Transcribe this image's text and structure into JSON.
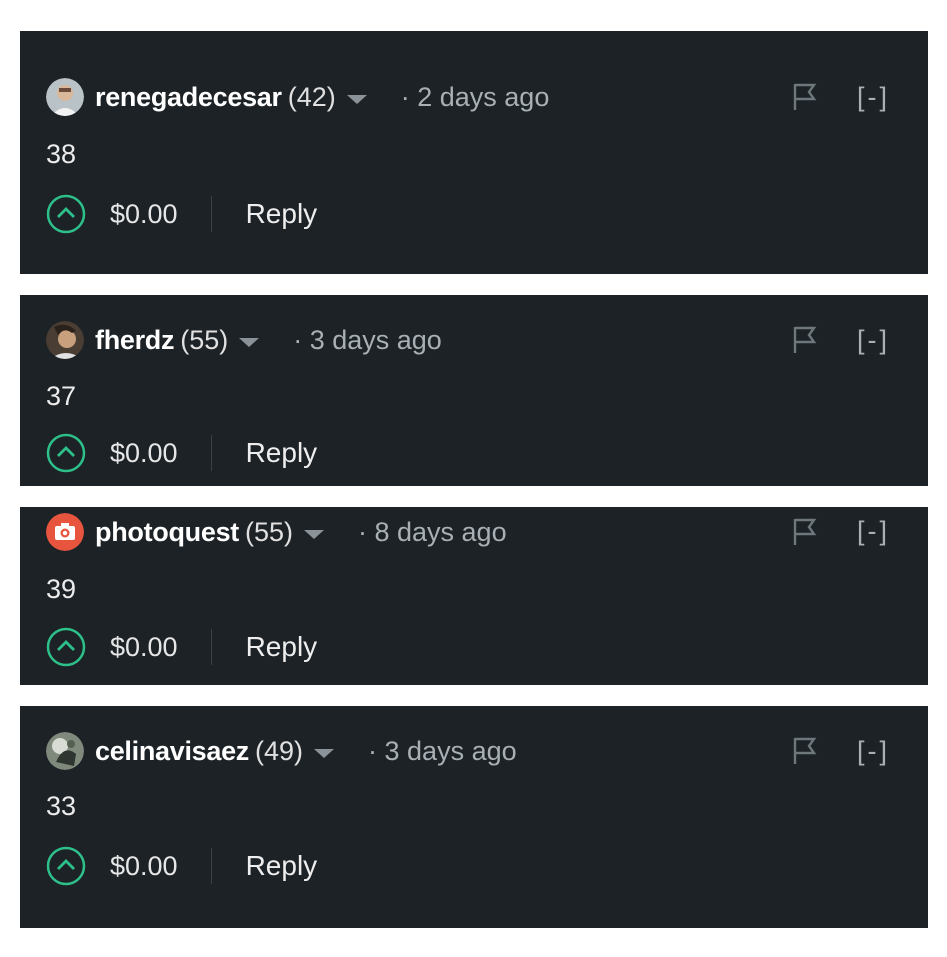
{
  "comments": [
    {
      "author": "renegadecesar",
      "reputation": "(42)",
      "time": "· 2 days ago",
      "body": "38",
      "payout": "$0.00",
      "reply": "Reply",
      "collapse": "[-]",
      "avatar": "portrait-avatar"
    },
    {
      "author": "fherdz",
      "reputation": "(55)",
      "time": "· 3 days ago",
      "body": "37",
      "payout": "$0.00",
      "reply": "Reply",
      "collapse": "[-]",
      "avatar": "portrait-avatar"
    },
    {
      "author": "photoquest",
      "reputation": "(55)",
      "time": "· 8 days ago",
      "body": "39",
      "payout": "$0.00",
      "reply": "Reply",
      "collapse": "[-]",
      "avatar": "camera-icon"
    },
    {
      "author": "celinavisaez",
      "reputation": "(49)",
      "time": "· 3 days ago",
      "body": "33",
      "payout": "$0.00",
      "reply": "Reply",
      "collapse": "[-]",
      "avatar": "portrait-avatar"
    }
  ],
  "colors": {
    "card_bg": "#1c2226",
    "upvote": "#2ec08a",
    "camera_avatar": "#e8553f"
  }
}
